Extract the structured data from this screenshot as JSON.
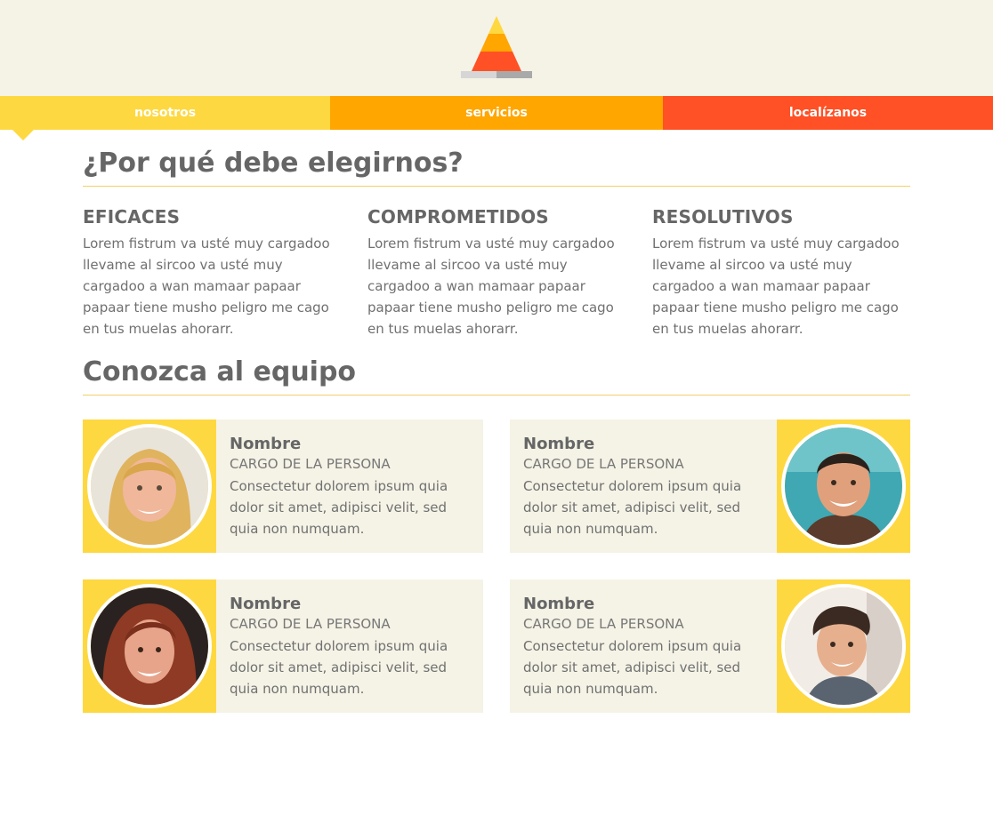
{
  "header": {
    "logo": "pyramid-logo"
  },
  "nav": {
    "items": [
      {
        "label": "nosotros",
        "color": "#fed840"
      },
      {
        "label": "servicios",
        "color": "#ffa600"
      },
      {
        "label": "localízanos",
        "color": "#ff5125"
      }
    ]
  },
  "why": {
    "title": "¿Por qué debe elegirnos?",
    "features": [
      {
        "title": "EFICACES",
        "text": "Lorem fistrum va usté muy cargadoo llevame al sircoo va usté muy cargadoo a wan mamaar papaar papaar tiene musho peligro me cago en tus muelas ahorarr."
      },
      {
        "title": "COMPROMETIDOS",
        "text": "Lorem fistrum va usté muy cargadoo llevame al sircoo va usté muy cargadoo a wan mamaar papaar papaar tiene musho peligro me cago en tus muelas ahorarr."
      },
      {
        "title": "RESOLUTIVOS",
        "text": "Lorem fistrum va usté muy cargadoo llevame al sircoo va usté muy cargadoo a wan mamaar papaar papaar tiene musho peligro me cago en tus muelas ahorarr."
      }
    ]
  },
  "team": {
    "title": "Conozca al equipo",
    "members": [
      {
        "name": "Nombre",
        "role": "CARGO DE LA PERSONA",
        "desc": "Consectetur dolorem ipsum quia dolor sit amet, adipisci velit, sed quia non numquam."
      },
      {
        "name": "Nombre",
        "role": "CARGO DE LA PERSONA",
        "desc": "Consectetur dolorem ipsum quia dolor sit amet, adipisci velit, sed quia non numquam."
      },
      {
        "name": "Nombre",
        "role": "CARGO DE LA PERSONA",
        "desc": "Consectetur dolorem ipsum quia dolor sit amet, adipisci velit, sed quia non numquam."
      },
      {
        "name": "Nombre",
        "role": "CARGO DE LA PERSONA",
        "desc": "Consectetur dolorem ipsum quia dolor sit amet, adipisci velit, sed quia non numquam."
      }
    ]
  },
  "colors": {
    "accent_yellow": "#fed840",
    "accent_orange": "#ffa600",
    "accent_red": "#ff5125",
    "cream": "#f5f3e6"
  }
}
